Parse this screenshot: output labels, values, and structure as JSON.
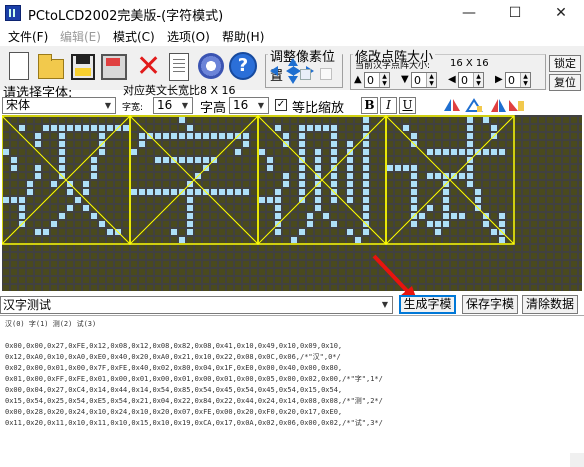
{
  "window": {
    "title": "PCtoLCD2002完美版-(字符模式)",
    "controls": {
      "minimize": "—",
      "maximize": "☐",
      "close": "✕"
    }
  },
  "menu": {
    "file": "文件(F)",
    "edit": "编辑(E)",
    "mode": "模式(C)",
    "options": "选项(O)",
    "help": "帮助(H)"
  },
  "toolbar": {
    "icons": [
      "new-document-icon",
      "open-folder-icon",
      "save-disk-icon",
      "save-as-disk-icon",
      "delete-icon",
      "page-icon",
      "settings-gear-icon",
      "help-icon"
    ],
    "help_glyph": "?"
  },
  "pixel_adjust": {
    "legend": "调整像素位置"
  },
  "lattice_size": {
    "legend": "修改点阵大小",
    "current_label": "当前汉字点阵大小:",
    "current_value": "16 X 16",
    "lock_label": "锁定",
    "reset_label": "复位",
    "spinners": [
      "0",
      "0",
      "0",
      "0"
    ]
  },
  "font_row": {
    "select_font_label": "请选择字体:",
    "dim_label": "对应英文长宽比8 X 16",
    "font_value": "宋体",
    "width_caption": "字宽:",
    "width_value": "16",
    "height_label": "字高",
    "height_value": "16",
    "checkbox_mark": "✓",
    "proportional_label": "等比缩放",
    "bold": "B",
    "italic": "I",
    "underline": "U"
  },
  "text_input": {
    "value": "汉字测试",
    "arrow": "▼"
  },
  "buttons": {
    "generate": "生成字模",
    "save": "保存字模",
    "clear": "清除数据"
  },
  "output": {
    "lines": [
      "汉(0) 字(1) 测(2) 试(3)",
      "",
      "0x00,0x00,0x27,0xFE,0x12,0x08,0x12,0x08,0x82,0x08,0x41,0x10,0x49,0x10,0x09,0x10,",
      "0x12,0xA0,0x10,0xA0,0xE0,0x40,0x20,0xA0,0x21,0x10,0x22,0x08,0x0C,0x06,/*\"汉\",0*/",
      "0x02,0x00,0x01,0x00,0x7F,0xFE,0x40,0x02,0x80,0x04,0x1F,0xE0,0x00,0x40,0x00,0x80,",
      "0x01,0x00,0xFF,0xFE,0x01,0x00,0x01,0x00,0x01,0x00,0x01,0x00,0x05,0x00,0x02,0x00,/*\"字\",1*/",
      "0x00,0x04,0x27,0xC4,0x14,0x44,0x14,0x54,0x85,0x54,0x45,0x54,0x45,0x54,0x15,0x54,",
      "0x15,0x54,0x25,0x54,0xE5,0x54,0x21,0x04,0x22,0x84,0x22,0x44,0x24,0x14,0x08,0x08,/*\"测\",2*/",
      "0x00,0x28,0x20,0x24,0x10,0x24,0x10,0x20,0x07,0xFE,0x00,0x20,0xF0,0x20,0x17,0xE0,",
      "0x11,0x20,0x11,0x10,0x11,0x10,0x15,0x10,0x19,0xCA,0x17,0x0A,0x02,0x06,0x00,0x02,/*\"试\",3*/"
    ]
  },
  "lattice": {
    "chars": [
      "汉",
      "字",
      "测",
      "试"
    ],
    "size": 16,
    "colors": {
      "background": "#414141",
      "grid": "#4a4a1e",
      "lit": "#aee0f8",
      "cell_border": "#ffff00"
    },
    "bitmaps": [
      [
        "0000000000000000",
        "0010011111111111",
        "0000100100001000",
        "0000100100001000",
        "1000000100001000",
        "0100000100010000",
        "0100100100010000",
        "0000100100010000",
        "0001001010100000",
        "0001000010100000",
        "1110000001000000",
        "0010000010100000",
        "0010000100010000",
        "0010001000001000",
        "0000110000000110",
        "0000000000000000"
      ],
      [
        "0000001000000000",
        "0000000100000000",
        "0111111111111110",
        "0100000000000010",
        "1000000000000100",
        "0001111111100000",
        "0000000001000000",
        "0000000010000000",
        "0000000100000000",
        "1111111111111110",
        "0000000100000000",
        "0000000100000000",
        "0000000100000000",
        "0000000100000000",
        "0000010100000000",
        "0000001000000000"
      ],
      [
        "0000000000000100",
        "0010011111000100",
        "0001010001000100",
        "0001010001010100",
        "1000010101010100",
        "0100010101010100",
        "0100010101010100",
        "0001010101010100",
        "0001010101010100",
        "0010010101010100",
        "1110010101010100",
        "0010000100000100",
        "0010001010000100",
        "0010001001000100",
        "0010010000010100",
        "0000100000001000"
      ],
      [
        "0000000000101000",
        "0010000000100100",
        "0001000000100100",
        "0001000000100000",
        "0000011111111110",
        "0000000000100000",
        "1111000000100000",
        "0001011111100000",
        "0001000100100000",
        "0001000100010000",
        "0001000100010000",
        "0001010100010000",
        "0001100111001010",
        "0001011100001010",
        "0000001000000110",
        "0000000000000010"
      ]
    ]
  }
}
